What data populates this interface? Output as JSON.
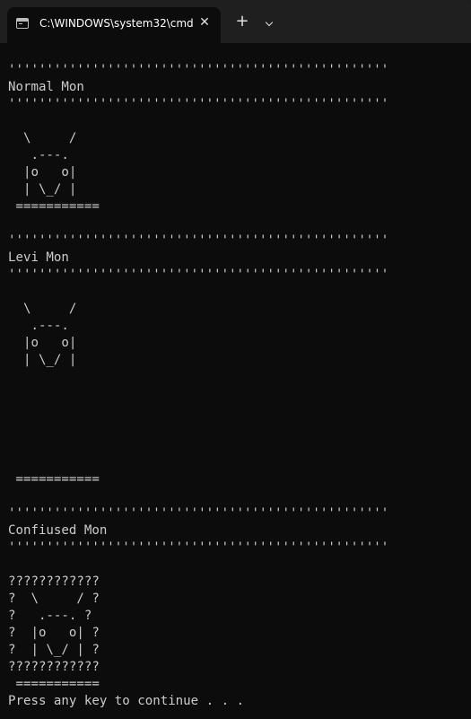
{
  "window": {
    "tab_title": "C:\\WINDOWS\\system32\\cmd.",
    "tab_close": "✕",
    "new_tab": "+",
    "tab_icon": "terminal-icon"
  },
  "terminal": {
    "lines": [
      "''''''''''''''''''''''''''''''''''''''''''''''''''",
      "Normal Mon",
      "''''''''''''''''''''''''''''''''''''''''''''''''''",
      "",
      "  \\     /",
      "   .---.",
      "  |o   o|",
      "  | \\_/ |",
      " ===========",
      "",
      "''''''''''''''''''''''''''''''''''''''''''''''''''",
      "Levi Mon",
      "''''''''''''''''''''''''''''''''''''''''''''''''''",
      "",
      "  \\     /",
      "   .---.",
      "  |o   o|",
      "  | \\_/ |",
      "",
      "",
      "",
      "",
      "",
      "",
      " ===========",
      "",
      "''''''''''''''''''''''''''''''''''''''''''''''''''",
      "Confiused Mon",
      "''''''''''''''''''''''''''''''''''''''''''''''''''",
      "",
      "????????????",
      "?  \\     / ?",
      "?   .---. ?",
      "?  |o   o| ?",
      "?  | \\_/ | ?",
      "????????????",
      " ===========",
      "Press any key to continue . . ."
    ]
  }
}
